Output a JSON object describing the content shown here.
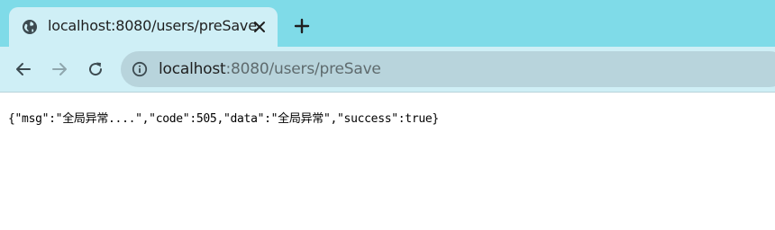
{
  "tab": {
    "title": "localhost:8080/users/preSave",
    "favicon": "globe-icon",
    "close_icon": "close-icon"
  },
  "new_tab_icon": "plus-icon",
  "toolbar": {
    "back_icon": "arrow-left-icon",
    "forward_icon": "arrow-right-icon",
    "reload_icon": "reload-icon",
    "site_info_icon": "info-icon",
    "url_host": "localhost",
    "url_rest": ":8080/users/preSave"
  },
  "page": {
    "body_text": "{\"msg\":\"全局异常....\",\"code\":505,\"data\":\"全局异常\",\"success\":true}"
  },
  "colors": {
    "tabstrip": "#7fdbe8",
    "toolbar": "#cfeff6",
    "omnibox": "#b8d4dc"
  }
}
